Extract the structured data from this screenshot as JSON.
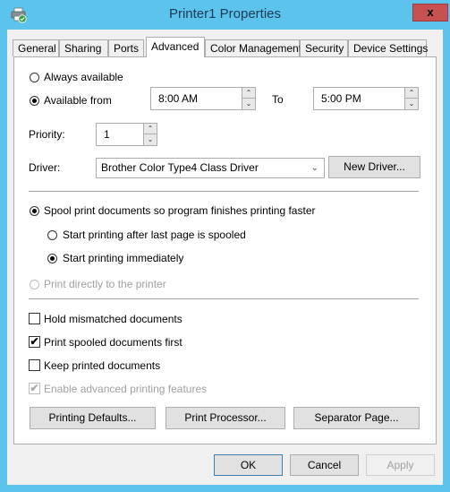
{
  "window": {
    "title": "Printer1 Properties",
    "close_label": "x"
  },
  "tabs": [
    {
      "label": "General",
      "active": false
    },
    {
      "label": "Sharing",
      "active": false
    },
    {
      "label": "Ports",
      "active": false
    },
    {
      "label": "Advanced",
      "active": true
    },
    {
      "label": "Color Management",
      "active": false
    },
    {
      "label": "Security",
      "active": false
    },
    {
      "label": "Device Settings",
      "active": false
    }
  ],
  "availability": {
    "always_label": "Always available",
    "always_checked": false,
    "from_label": "Available from",
    "from_checked": true,
    "from_time": "8:00 AM",
    "to_label": "To",
    "to_time": "5:00 PM"
  },
  "priority": {
    "label": "Priority:",
    "value": "1"
  },
  "driver": {
    "label": "Driver:",
    "selected": "Brother Color Type4 Class Driver",
    "new_driver_label": "New Driver..."
  },
  "spooling": {
    "spool_label": "Spool print documents so program finishes printing faster",
    "spool_checked": true,
    "after_last_label": "Start printing after last page is spooled",
    "after_last_checked": false,
    "immediately_label": "Start printing immediately",
    "immediately_checked": true,
    "direct_label": "Print directly to the printer",
    "direct_checked": false
  },
  "options": {
    "hold_mismatched_label": "Hold mismatched documents",
    "hold_mismatched_checked": false,
    "spooled_first_label": "Print spooled documents first",
    "spooled_first_checked": true,
    "keep_printed_label": "Keep printed documents",
    "keep_printed_checked": false,
    "advanced_features_label": "Enable advanced printing features",
    "advanced_features_checked": true
  },
  "buttons": {
    "printing_defaults": "Printing Defaults...",
    "print_processor": "Print Processor...",
    "separator_page": "Separator Page...",
    "ok": "OK",
    "cancel": "Cancel",
    "apply": "Apply"
  }
}
